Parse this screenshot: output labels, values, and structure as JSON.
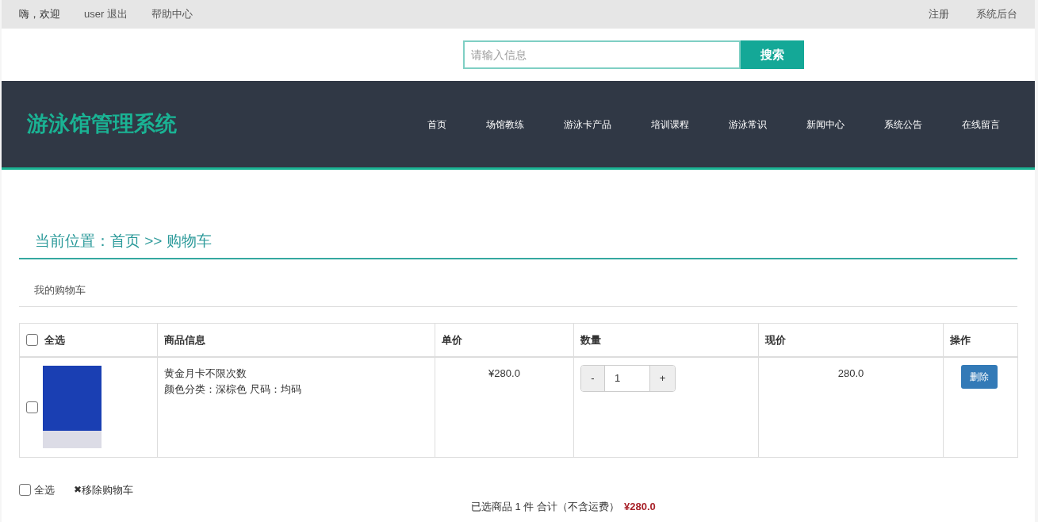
{
  "top_bar": {
    "left": [
      {
        "kind": "text",
        "label": "嗨，欢迎"
      },
      {
        "kind": "link",
        "label": "user 退出"
      },
      {
        "kind": "link",
        "label": "帮助中心"
      }
    ],
    "right": [
      {
        "label": "注册"
      },
      {
        "label": "系统后台"
      }
    ]
  },
  "search": {
    "placeholder": "请输入信息",
    "button": "搜索"
  },
  "header": {
    "title": "游泳馆管理系统",
    "nav": [
      {
        "label": "首页",
        "selected": false
      },
      {
        "label": "场馆教练",
        "selected": false
      },
      {
        "label": "游泳卡产品",
        "selected": false
      },
      {
        "label": "培训课程",
        "selected": false
      },
      {
        "label": "游泳常识",
        "selected": false
      },
      {
        "label": "新闻中心",
        "selected": false
      },
      {
        "label": "系统公告",
        "selected": false
      },
      {
        "label": "在线留言",
        "selected": false
      }
    ]
  },
  "breadcrumb": "当前位置：首页 >> 购物车",
  "section_title": "我的购物车",
  "table": {
    "columns": [
      "全选",
      "商品信息",
      "单价",
      "数量",
      "现价",
      "操作"
    ],
    "select_all_checked": false,
    "rows": [
      {
        "checked": false,
        "name": "黄金月卡不限次数",
        "spec": "颜色分类：深棕色 尺码：均码",
        "unit_price": "¥280.0",
        "minus": "-",
        "quantity": "1",
        "plus": "+",
        "price": "280.0",
        "action": "删除"
      }
    ]
  },
  "footer": {
    "select_all": "全选",
    "select_all_checked": false,
    "remove_icon": "✖",
    "remove": "移除购物车",
    "summary": "已选商品 1 件 合计（不含运费）",
    "total": "¥280.0"
  }
}
